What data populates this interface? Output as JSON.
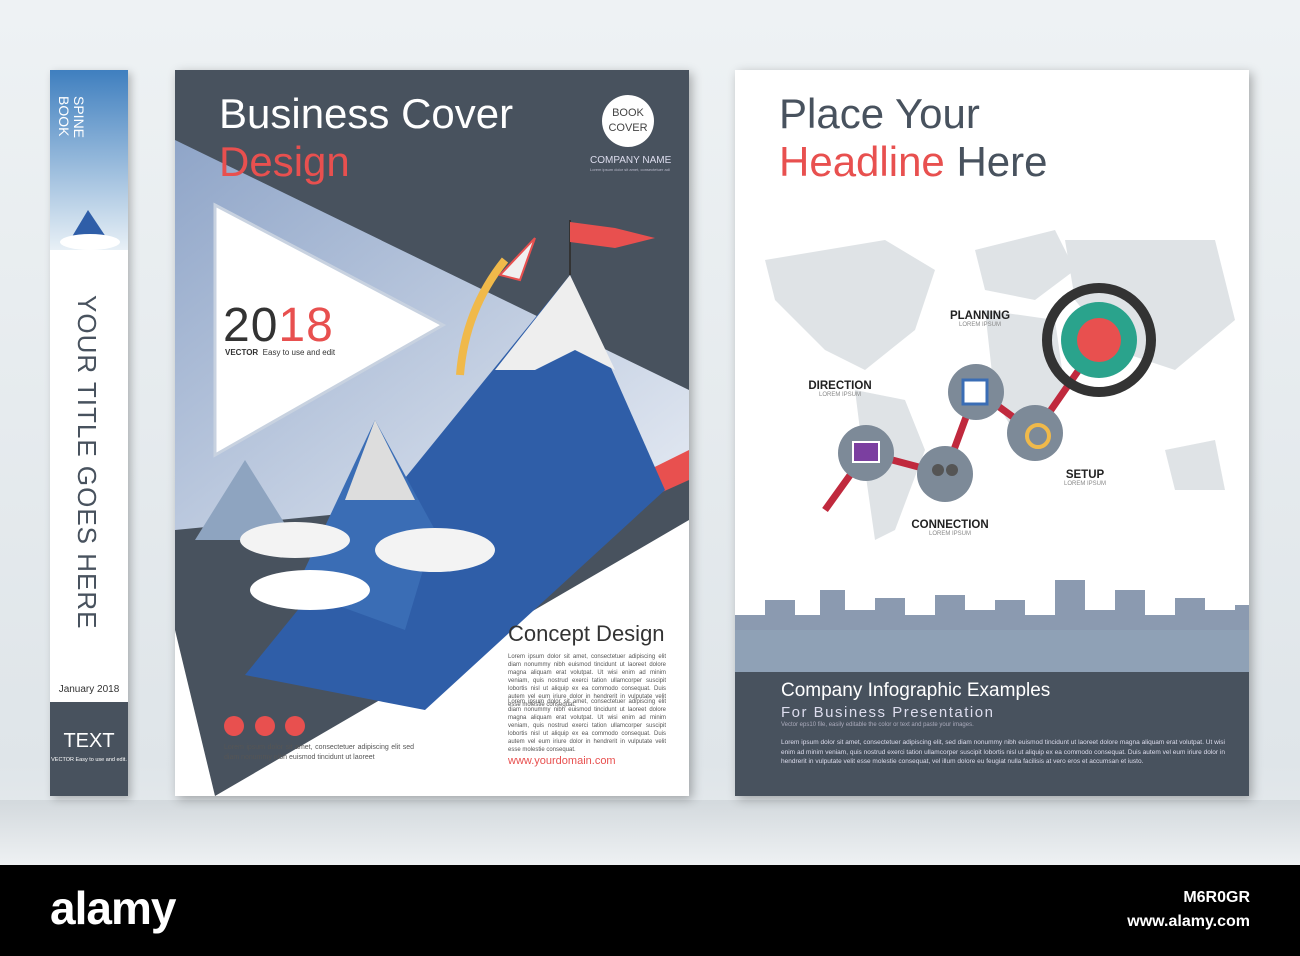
{
  "spine": {
    "top_label_1": "SPINE",
    "top_label_2": "BOOK",
    "title": "YOUR TITLE GOES HERE",
    "date": "January 2018",
    "bottom_title": "TEXT",
    "bottom_sub": "VECTOR  Easy to use and edit."
  },
  "front": {
    "title_line1": "Business Cover",
    "title_line2": "Design",
    "badge_line1": "BOOK",
    "badge_line2": "COVER",
    "company": "COMPANY NAME",
    "company_sub": "Lorem ipsum dolor sit amet, consectetuer adipiscing",
    "year_a": "20",
    "year_b": "18",
    "year_sub_a": "VECTOR",
    "year_sub_b": "Easy to use and edit",
    "section_title": "Concept Design",
    "para1": "Lorem ipsum dolor sit amet, consectetuer adipiscing elit diam nonummy nibh euismod tincidunt ut laoreet dolore magna aliquam erat volutpat. Ut wisi enim ad minim veniam, quis nostrud exerci tation ullamcorper suscipit lobortis nisl ut aliquip ex ea commodo consequat. Duis autem vel eum iriure dolor in hendrerit in vulputate velit esse molestie consequat.",
    "para2": "Lorem ipsum dolor sit amet, consectetuer adipiscing elit diam nonummy nibh euismod tincidunt ut laoreet dolore magna aliquam erat volutpat. Ut wisi enim ad minim veniam, quis nostrud exerci tation ullamcorper suscipit lobortis nisl ut aliquip ex ea commodo consequat. Duis autem vel eum iriure dolor in hendrerit in vulputate velit esse molestie consequat.",
    "footer_text": "Lorem ipsum dolor sit amet, consectetuer adipiscing elit sed diam nonummy nibh euismod tincidunt ut laoreet",
    "url": "www.yourdomain.com"
  },
  "back": {
    "headline_1": "Place Your",
    "headline_2a": "Headline",
    "headline_2b": " Here",
    "steps": [
      {
        "label": "DIRECTION",
        "sub": "LOREM IPSUM"
      },
      {
        "label": "PLANNING",
        "sub": "LOREM IPSUM"
      },
      {
        "label": "CONNECTION",
        "sub": "LOREM IPSUM"
      },
      {
        "label": "SETUP",
        "sub": "LOREM IPSUM"
      }
    ],
    "band_title": "Company Infographic Examples",
    "band_sub": "For Business Presentation",
    "band_note": "Vector eps10 file, easily editable the color or text and paste your images.",
    "band_para": "Lorem ipsum dolor sit amet, consectetuer adipiscing elit, sed diam nonummy nibh euismod tincidunt ut laoreet dolore magna aliquam erat volutpat. Ut wisi enim ad minim veniam, quis nostrud exerci tation ullamcorper suscipit lobortis nisl ut aliquip ex ea commodo consequat. Duis autem vel eum iriure dolor in hendrerit in vulputate velit esse molestie consequat, vel illum dolore eu feugiat nulla facilisis at vero eros et accumsan et iusto."
  },
  "watermark": {
    "logo": "alamy",
    "image_id": "M6R0GR",
    "site": "www.alamy.com"
  },
  "colors": {
    "dark": "#48525e",
    "red": "#e8504f",
    "blue": "#3a6db5"
  }
}
